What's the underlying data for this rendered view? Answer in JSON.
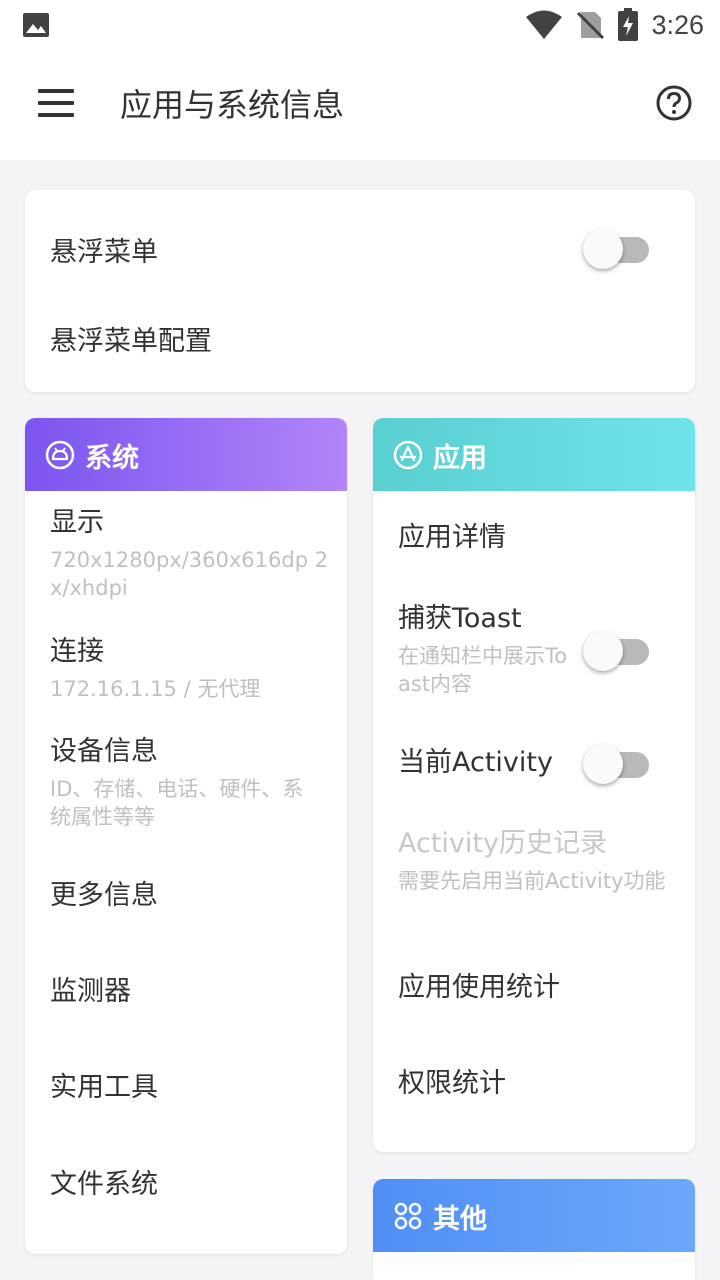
{
  "status_bar": {
    "time": "3:26",
    "icons": [
      "gallery-icon",
      "wifi-icon",
      "no-sim-icon",
      "battery-charging-icon"
    ]
  },
  "app_bar": {
    "title": "应用与系统信息",
    "menu_icon": "hamburger-menu-icon",
    "help_icon": "help-circle-icon"
  },
  "float_menu_card": {
    "toggle_label": "悬浮菜单",
    "toggle_on": false,
    "config_label": "悬浮菜单配置"
  },
  "system_card": {
    "title": "系统",
    "icon": "android-icon",
    "items": [
      {
        "title": "显示",
        "subtitle": "720x1280px/360x616dp 2x/xhdpi"
      },
      {
        "title": "连接",
        "subtitle": "172.16.1.15 / 无代理"
      },
      {
        "title": "设备信息",
        "subtitle": "ID、存储、电话、硬件、系统属性等等"
      },
      {
        "title": "更多信息"
      },
      {
        "title": "监测器"
      },
      {
        "title": "实用工具"
      },
      {
        "title": "文件系统"
      }
    ]
  },
  "app_card": {
    "title": "应用",
    "icon": "app-store-icon",
    "items": [
      {
        "title": "应用详情"
      },
      {
        "title": "捕获Toast",
        "subtitle": "在通知栏中展示Toast内容",
        "toggle_on": false
      },
      {
        "title": "当前Activity",
        "toggle_on": false
      },
      {
        "title": "Activity历史记录",
        "subtitle": "需要先启用当前Activity功能",
        "disabled": true
      },
      {
        "title": "应用使用统计"
      },
      {
        "title": "权限统计"
      }
    ]
  },
  "other_card": {
    "title": "其他",
    "icon": "grid-icon"
  },
  "colors": {
    "system_gradient": [
      "#7b55f0",
      "#b285f8"
    ],
    "app_gradient": [
      "#59cfd2",
      "#6ee3ea"
    ],
    "other_gradient": [
      "#4f8ff5",
      "#6aa8fb"
    ],
    "background": "#f4f4f6"
  }
}
